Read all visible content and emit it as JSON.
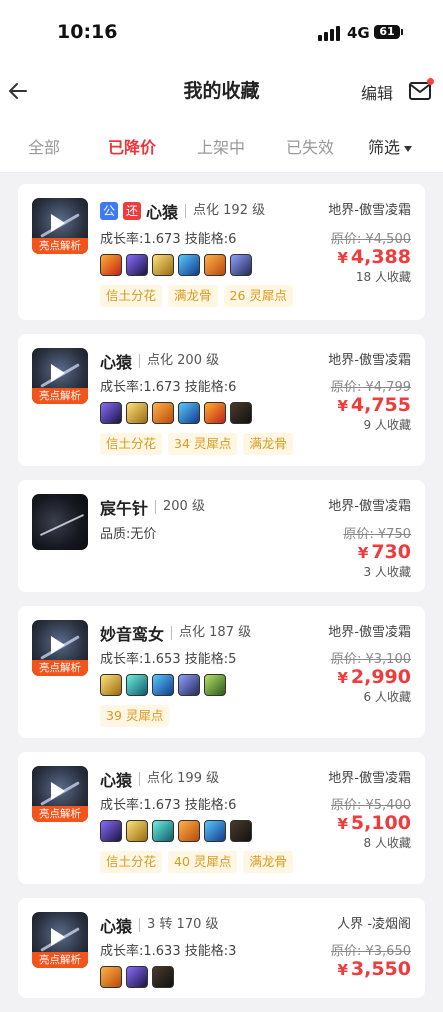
{
  "status": {
    "time": "10:16",
    "network": "4G",
    "battery": "61"
  },
  "nav": {
    "title": "我的收藏",
    "edit": "编辑"
  },
  "tabs": [
    "全部",
    "已降价",
    "上架中",
    "已失效",
    "筛选"
  ],
  "colors": {
    "accent": "#e8383d",
    "chip_bg": "#fff6e3",
    "chip_text": "#d99a1d",
    "badge": "#f2541b"
  },
  "items": [
    {
      "name": "心猿",
      "tags": [
        "公",
        "还"
      ],
      "level": "点化 192 级",
      "attr": "成长率:1.673 技能格:6",
      "server": "地界-傲雪凌霜",
      "original": "原价: ¥4,500",
      "currency": "¥",
      "price": "4,388",
      "fav": "18 人收藏",
      "badge": "亮点解析",
      "chips": [
        "信土分花",
        "满龙骨",
        "26 灵犀点"
      ],
      "skills": [
        "fire",
        "star",
        "gold",
        "blue",
        "orange",
        "storm"
      ]
    },
    {
      "name": "心猿",
      "tags": [],
      "level": "点化 200 级",
      "attr": "成长率:1.673 技能格:6",
      "server": "地界-傲雪凌霜",
      "original": "原价: ¥4,799",
      "currency": "¥",
      "price": "4,755",
      "fav": "9 人收藏",
      "badge": "亮点解析",
      "chips": [
        "信土分花",
        "34 灵犀点",
        "满龙骨"
      ],
      "skills": [
        "star",
        "gold",
        "orange",
        "blue",
        "fire",
        "dark"
      ]
    },
    {
      "name": "宸午针",
      "tags": [],
      "level": "200 级",
      "attr": "品质:无价",
      "server": "地界-傲雪凌霜",
      "original": "原价: ¥750",
      "currency": "¥",
      "price": "730",
      "fav": "3 人收藏",
      "badge": "",
      "chips": [],
      "skills": []
    },
    {
      "name": "妙音鸾女",
      "tags": [],
      "level": "点化 187 级",
      "attr": "成长率:1.653 技能格:5",
      "server": "地界-傲雪凌霜",
      "original": "原价: ¥3,100",
      "currency": "¥",
      "price": "2,990",
      "fav": "6 人收藏",
      "badge": "亮点解析",
      "chips": [
        "39 灵犀点"
      ],
      "skills": [
        "gold",
        "cyan",
        "blue",
        "storm",
        "green"
      ]
    },
    {
      "name": "心猿",
      "tags": [],
      "level": "点化 199 级",
      "attr": "成长率:1.673 技能格:6",
      "server": "地界-傲雪凌霜",
      "original": "原价: ¥5,400",
      "currency": "¥",
      "price": "5,100",
      "fav": "8 人收藏",
      "badge": "亮点解析",
      "chips": [
        "信土分花",
        "40 灵犀点",
        "满龙骨"
      ],
      "skills": [
        "star",
        "gold",
        "cyan",
        "orange",
        "blue",
        "dark"
      ]
    },
    {
      "name": "心猿",
      "tags": [],
      "level": "3 转 170 级",
      "attr": "成长率:1.633 技能格:3",
      "server": "人界 -凌烟阁",
      "original": "原价: ¥3,650",
      "currency": "¥",
      "price": "3,550",
      "fav": "",
      "badge": "亮点解析",
      "chips": [],
      "skills": [
        "orange",
        "star",
        "dark"
      ]
    }
  ]
}
